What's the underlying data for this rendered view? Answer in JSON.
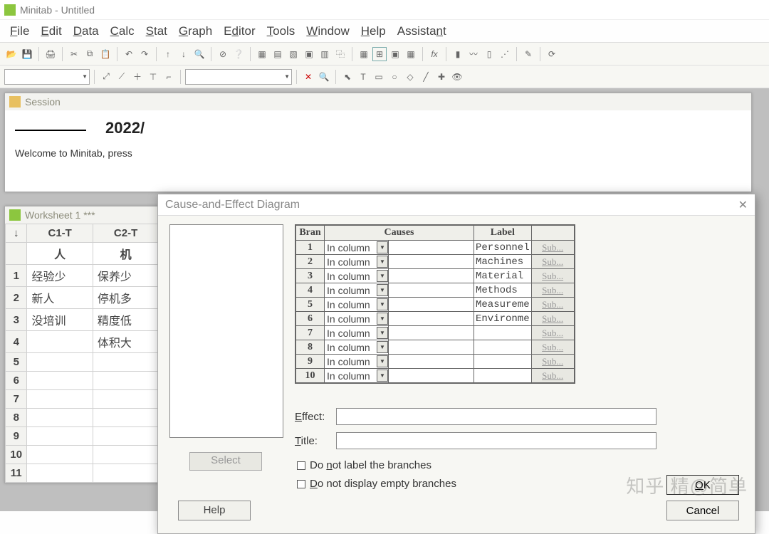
{
  "window": {
    "title": "Minitab - Untitled"
  },
  "menu": [
    "File",
    "Edit",
    "Data",
    "Calc",
    "Stat",
    "Graph",
    "Editor",
    "Tools",
    "Window",
    "Help",
    "Assistant"
  ],
  "session": {
    "title": "Session",
    "date": "2022/",
    "welcome": "Welcome to Minitab, press"
  },
  "worksheet": {
    "title": "Worksheet 1 ***",
    "col_headers": [
      "C1-T",
      "C2-T"
    ],
    "name_row": [
      "人",
      "机"
    ],
    "rows": [
      [
        "经验少",
        "保养少"
      ],
      [
        "新人",
        "停机多"
      ],
      [
        "没培训",
        "精度低"
      ],
      [
        "",
        "体积大"
      ],
      [
        "",
        ""
      ],
      [
        "",
        ""
      ],
      [
        "",
        ""
      ],
      [
        "",
        ""
      ],
      [
        "",
        ""
      ],
      [
        "",
        ""
      ],
      [
        "",
        ""
      ]
    ]
  },
  "dialog": {
    "title": "Cause-and-Effect Diagram",
    "headers": {
      "branch": "Bran",
      "causes": "Causes",
      "label": "Label"
    },
    "rows": [
      {
        "n": "1",
        "type": "In column",
        "label": "Personnel"
      },
      {
        "n": "2",
        "type": "In column",
        "label": "Machines"
      },
      {
        "n": "3",
        "type": "In column",
        "label": "Material"
      },
      {
        "n": "4",
        "type": "In column",
        "label": "Methods"
      },
      {
        "n": "5",
        "type": "In column",
        "label": "Measureme"
      },
      {
        "n": "6",
        "type": "In column",
        "label": "Environme"
      },
      {
        "n": "7",
        "type": "In column",
        "label": ""
      },
      {
        "n": "8",
        "type": "In column",
        "label": ""
      },
      {
        "n": "9",
        "type": "In column",
        "label": ""
      },
      {
        "n": "10",
        "type": "In column",
        "label": ""
      }
    ],
    "sub_label": "Sub...",
    "effect_label": "Effect:",
    "effect_value": "",
    "title_label": "Title:",
    "title_value": "",
    "check1": "Do not label the branches",
    "check2": "Do not display empty branches",
    "select": "Select",
    "help": "Help",
    "ok": "OK",
    "cancel": "Cancel"
  },
  "watermark": "知乎 精@简单"
}
